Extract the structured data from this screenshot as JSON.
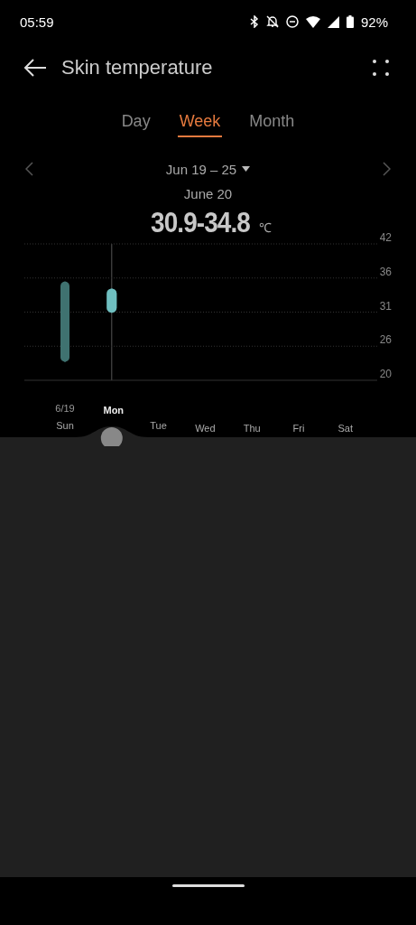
{
  "status_bar": {
    "time": "05:59",
    "battery": "92%"
  },
  "header": {
    "title": "Skin temperature"
  },
  "tabs": [
    {
      "label": "Day",
      "selected": false
    },
    {
      "label": "Week",
      "selected": true
    },
    {
      "label": "Month",
      "selected": false
    }
  ],
  "date_range": {
    "label": "Jun 19 – 25"
  },
  "summary": {
    "date": "June 20",
    "reading": "30.9-34.8",
    "unit": "℃"
  },
  "chart": {
    "date_label": "6/19",
    "days": [
      {
        "selected": false
      },
      {
        "selected": true
      },
      {
        "selected": false
      },
      {
        "selected": false
      },
      {
        "selected": false
      },
      {
        "selected": false
      },
      {
        "selected": false
      }
    ],
    "chart_data": {
      "type": "candlestick",
      "categories": [
        "Sun",
        "Mon",
        "Tue",
        "Wed",
        "Thu",
        "Fri",
        "Sat"
      ],
      "ohlc": [
        [
          23.0,
          35.9,
          23.0,
          35.9
        ],
        [
          30.9,
          34.8,
          30.9,
          34.8
        ],
        null,
        null,
        null,
        null,
        null
      ],
      "ylim": [
        20,
        42
      ],
      "grid": true,
      "yticks": [
        {
          "value": 42,
          "label": "42"
        },
        {
          "value": 36.5,
          "label": "36"
        },
        {
          "value": 31,
          "label": "31"
        },
        {
          "value": 25.5,
          "label": "26"
        },
        {
          "value": 20,
          "label": "20"
        }
      ]
    }
  }
}
